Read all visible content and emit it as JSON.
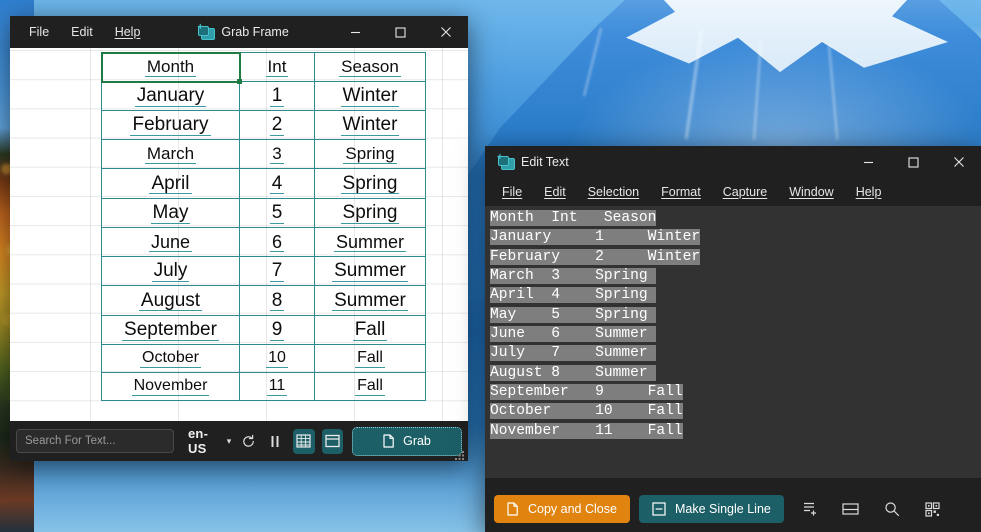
{
  "desktop": {
    "wallpaper_name": "mount-fuji-wallpaper",
    "side_image_name": "autumn-foliage-image"
  },
  "grab_window": {
    "title": "Grab Frame",
    "icon": "grab-frame-app-icon",
    "menu": [
      {
        "label": "File",
        "mnemonic": "F"
      },
      {
        "label": "Edit",
        "mnemonic": "E"
      },
      {
        "label": "Help",
        "mnemonic": "H"
      }
    ],
    "window_controls": {
      "minimize": "minimize-icon",
      "maximize": "maximize-icon",
      "close": "close-icon"
    },
    "table": {
      "headers": [
        "Month",
        "Int",
        "Season"
      ],
      "rows": [
        [
          "January",
          "1",
          "Winter"
        ],
        [
          "February",
          "2",
          "Winter"
        ],
        [
          "March",
          "3",
          "Spring"
        ],
        [
          "April",
          "4",
          "Spring"
        ],
        [
          "May",
          "5",
          "Spring"
        ],
        [
          "June",
          "6",
          "Summer"
        ],
        [
          "July",
          "7",
          "Summer"
        ],
        [
          "August",
          "8",
          "Summer"
        ],
        [
          "September",
          "9",
          "Fall"
        ],
        [
          "October",
          "10",
          "Fall"
        ],
        [
          "November",
          "11",
          "Fall"
        ]
      ],
      "selected_cell": "Month"
    },
    "toolbar": {
      "search_placeholder": "Search For Text...",
      "search_value": "",
      "language": "en-US",
      "language_caret": "chevron-down-icon",
      "refresh_icon": "refresh-icon",
      "pause_icon": "pause-icon",
      "table_mode_icon": "table-grid-icon",
      "frame_mode_icon": "window-frame-icon",
      "grab_label": "Grab",
      "grab_icon": "copy-icon",
      "resize_grip": "resize-grip-icon"
    }
  },
  "edit_window": {
    "title": "Edit Text",
    "icon": "edit-text-app-icon",
    "menu": [
      {
        "label": "File",
        "mnemonic": "F"
      },
      {
        "label": "Edit",
        "mnemonic": "E"
      },
      {
        "label": "Selection",
        "mnemonic": "S"
      },
      {
        "label": "Format",
        "mnemonic": "o"
      },
      {
        "label": "Capture",
        "mnemonic": "C"
      },
      {
        "label": "Window",
        "mnemonic": "W"
      },
      {
        "label": "Help",
        "mnemonic": "H"
      }
    ],
    "window_controls": {
      "minimize": "minimize-icon",
      "maximize": "maximize-icon",
      "close": "close-icon"
    },
    "text_lines": [
      {
        "plain": "Month  Int   Season",
        "highlight_chars": 19
      },
      {
        "plain": "January     1     Winter",
        "highlight_chars": 24
      },
      {
        "plain": "February    2     Winter",
        "highlight_chars": 24
      },
      {
        "plain": "March  3    Spring",
        "highlight_chars": 19
      },
      {
        "plain": "April  4    Spring",
        "highlight_chars": 19
      },
      {
        "plain": "May    5    Spring",
        "highlight_chars": 19
      },
      {
        "plain": "June   6    Summer",
        "highlight_chars": 19
      },
      {
        "plain": "July   7    Summer",
        "highlight_chars": 19
      },
      {
        "plain": "August 8    Summer",
        "highlight_chars": 19
      },
      {
        "plain": "September   9     Fall",
        "highlight_chars": 22
      },
      {
        "plain": "October     10    Fall",
        "highlight_chars": 22
      },
      {
        "plain": "November    11    Fall",
        "highlight_chars": 22
      }
    ],
    "actions": {
      "copy_and_close_label": "Copy and Close",
      "copy_and_close_icon": "copy-icon",
      "copy_and_close_color": "#e0840f",
      "make_single_line_label": "Make Single Line",
      "make_single_line_icon": "single-line-icon",
      "make_single_line_color": "#1d5f66",
      "add_line_icon": "add-line-icon",
      "split_view_icon": "split-view-icon",
      "search_icon": "search-icon",
      "qr_icon": "qr-code-icon"
    }
  },
  "theme": {
    "accent_teal": "#1d5f66",
    "accent_orange": "#e0840f",
    "table_border": "#2d8b8f",
    "selection_green": "#1f7a44"
  }
}
